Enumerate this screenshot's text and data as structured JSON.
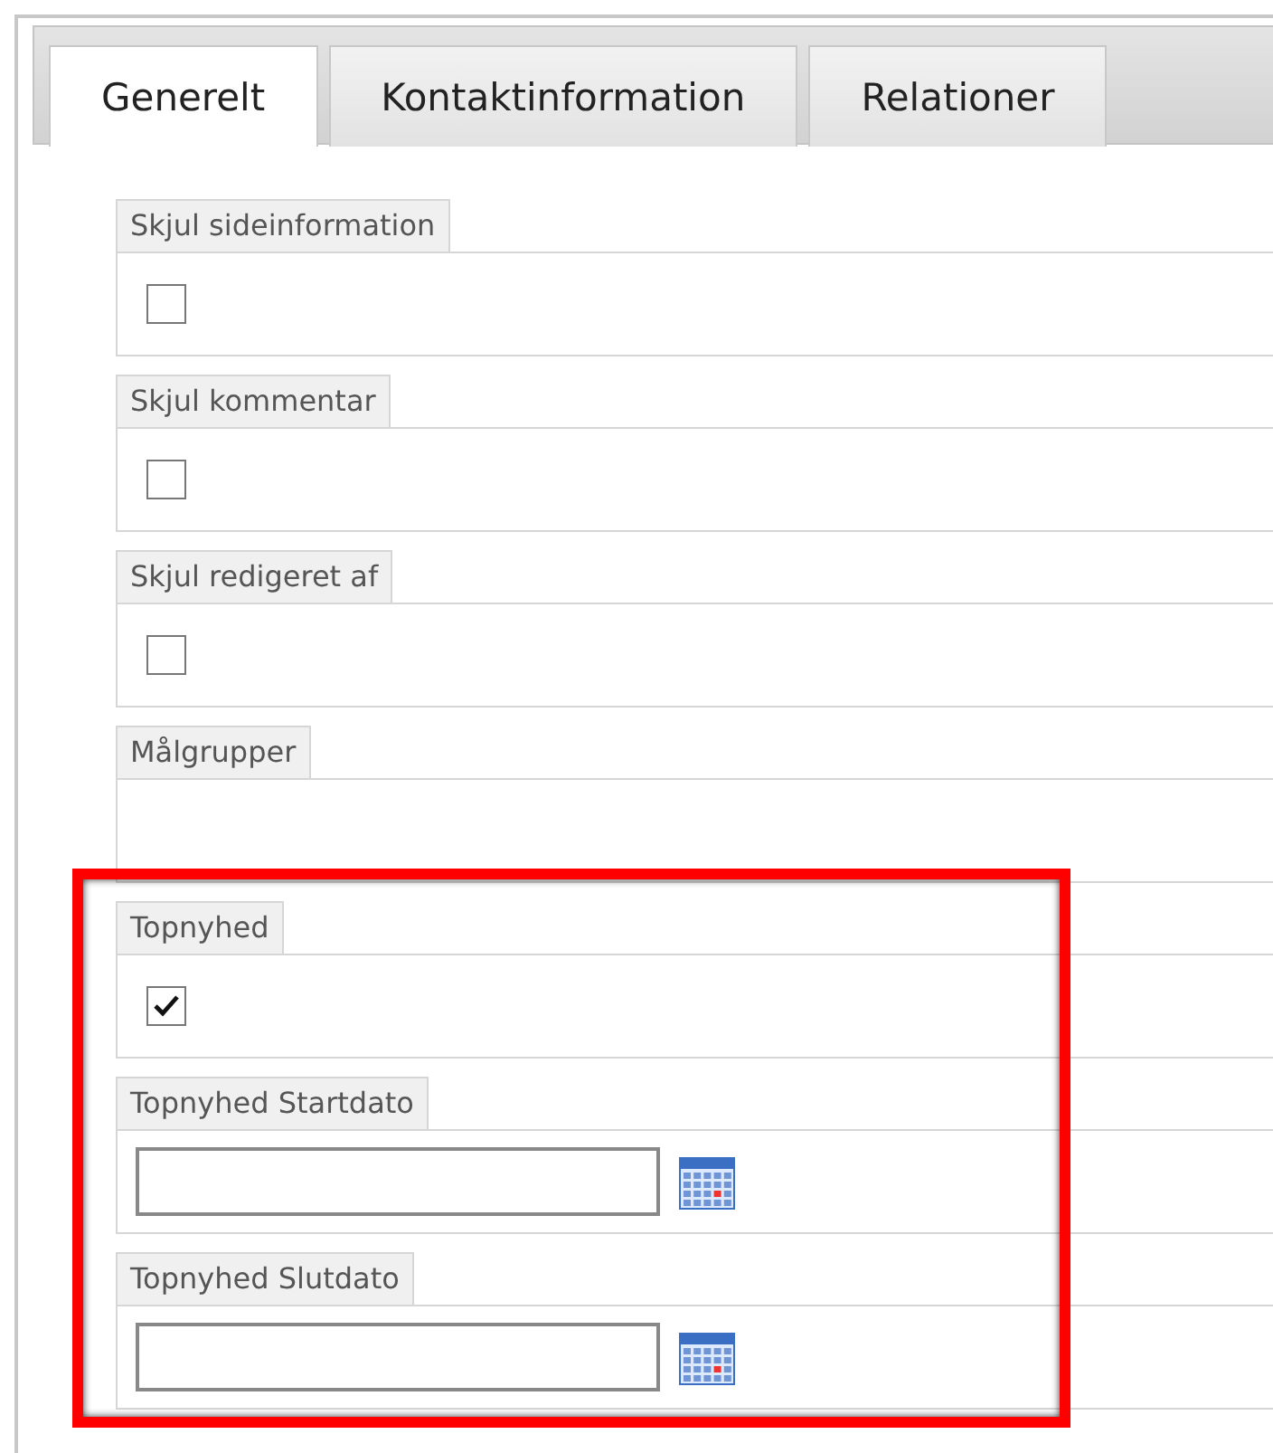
{
  "tabs": [
    {
      "label": "Generelt",
      "selected": true
    },
    {
      "label": "Kontaktinformation",
      "selected": false
    },
    {
      "label": "Relationer",
      "selected": false
    }
  ],
  "fields": [
    {
      "label": "Skjul sideinformation",
      "kind": "checkbox",
      "checked": false,
      "highlighted": false
    },
    {
      "label": "Skjul kommentar",
      "kind": "checkbox",
      "checked": false,
      "highlighted": false
    },
    {
      "label": "Skjul redigeret af",
      "kind": "checkbox",
      "checked": false,
      "highlighted": false
    },
    {
      "label": "Målgrupper",
      "kind": "empty",
      "highlighted": false
    },
    {
      "label": "Topnyhed",
      "kind": "checkbox",
      "checked": true,
      "highlighted": true
    },
    {
      "label": "Topnyhed Startdato",
      "kind": "date",
      "highlighted": true
    },
    {
      "label": "Topnyhed Slutdato",
      "kind": "date",
      "highlighted": true
    }
  ]
}
